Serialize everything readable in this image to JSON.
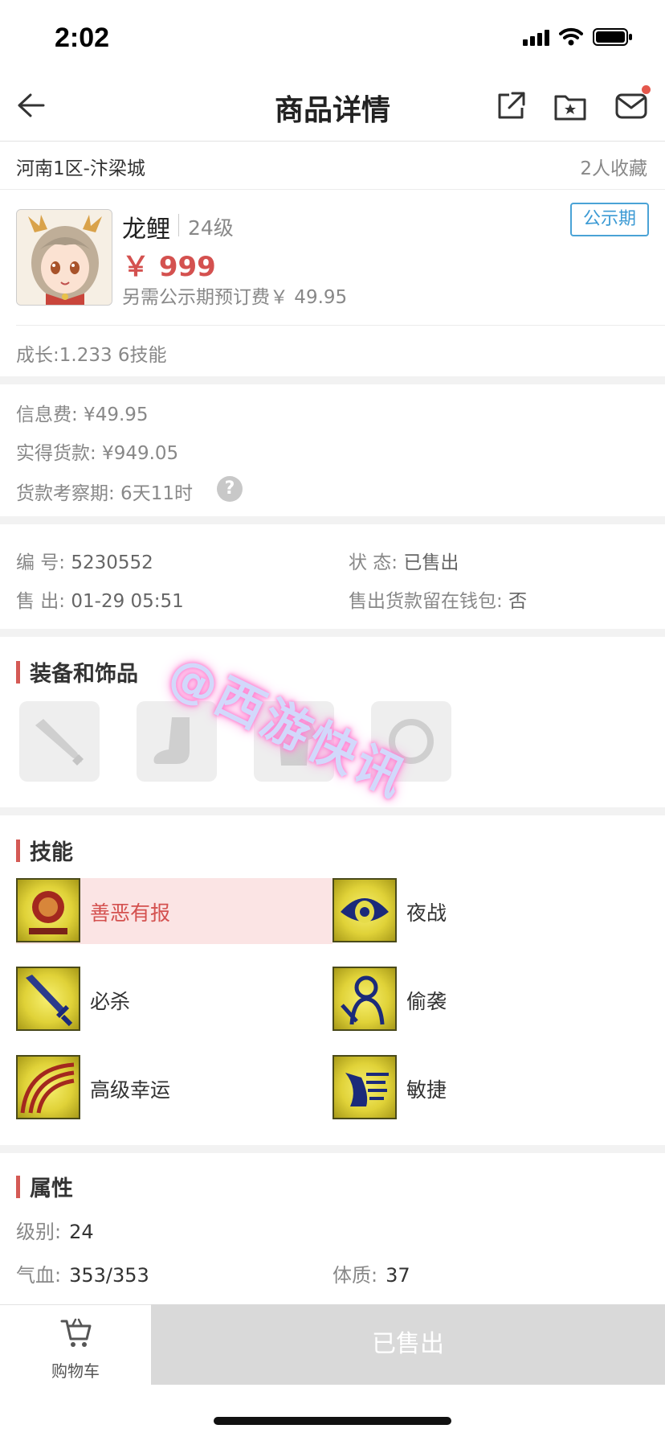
{
  "status_bar": {
    "time": "2:02"
  },
  "nav": {
    "title": "商品详情"
  },
  "server": {
    "name": "河南1区-汴梁城",
    "fav_count": "2人收藏"
  },
  "product": {
    "name": "龙鲤",
    "level": "24级",
    "price": "￥ 999",
    "deposit_note": "另需公示期预订费￥ 49.95",
    "public_tag": "公示期",
    "growth": "成长:1.233  6技能"
  },
  "fees": {
    "info_fee": "信息费: ¥49.95",
    "actual_payment": "实得货款: ¥949.05",
    "review_period": "货款考察期: 6天11时",
    "help_mark": "?"
  },
  "info": {
    "serial_label": "编 号:",
    "serial_value": "5230552",
    "status_label": "状 态:",
    "status_value": "已售出",
    "sold_label": "售 出:",
    "sold_value": "01-29 05:51",
    "wallet_label": "售出货款留在钱包:",
    "wallet_value": "否"
  },
  "equipment": {
    "title": "装备和饰品",
    "slots": [
      "weapon-slot-icon",
      "boot-slot-icon",
      "armor-slot-icon",
      "accessory-slot-icon"
    ]
  },
  "watermark": "@西游快讯",
  "skills": {
    "title": "技能",
    "items": [
      {
        "name": "善恶有报",
        "icon": "karma-seal-icon",
        "highlight": true
      },
      {
        "name": "夜战",
        "icon": "eye-icon",
        "highlight": false
      },
      {
        "name": "必杀",
        "icon": "sword-icon",
        "highlight": false
      },
      {
        "name": "偷袭",
        "icon": "sneak-figure-icon",
        "highlight": false
      },
      {
        "name": "高级幸运",
        "icon": "rainbow-icon",
        "highlight": false
      },
      {
        "name": "敏捷",
        "icon": "swift-icon",
        "highlight": false
      }
    ]
  },
  "attributes": {
    "title": "属性",
    "level_label": "级别:",
    "level_value": "24",
    "hp_label": "气血:",
    "hp_value": "353/353",
    "con_label": "体质:",
    "con_value": "37"
  },
  "bottom": {
    "cart_label": "购物车",
    "sold_label": "已售出"
  },
  "colors": {
    "price_red": "#d4514f",
    "accent_blue": "#3b9ad4",
    "section_bar": "#d45a55",
    "highlight_bg": "#fbe4e4"
  }
}
